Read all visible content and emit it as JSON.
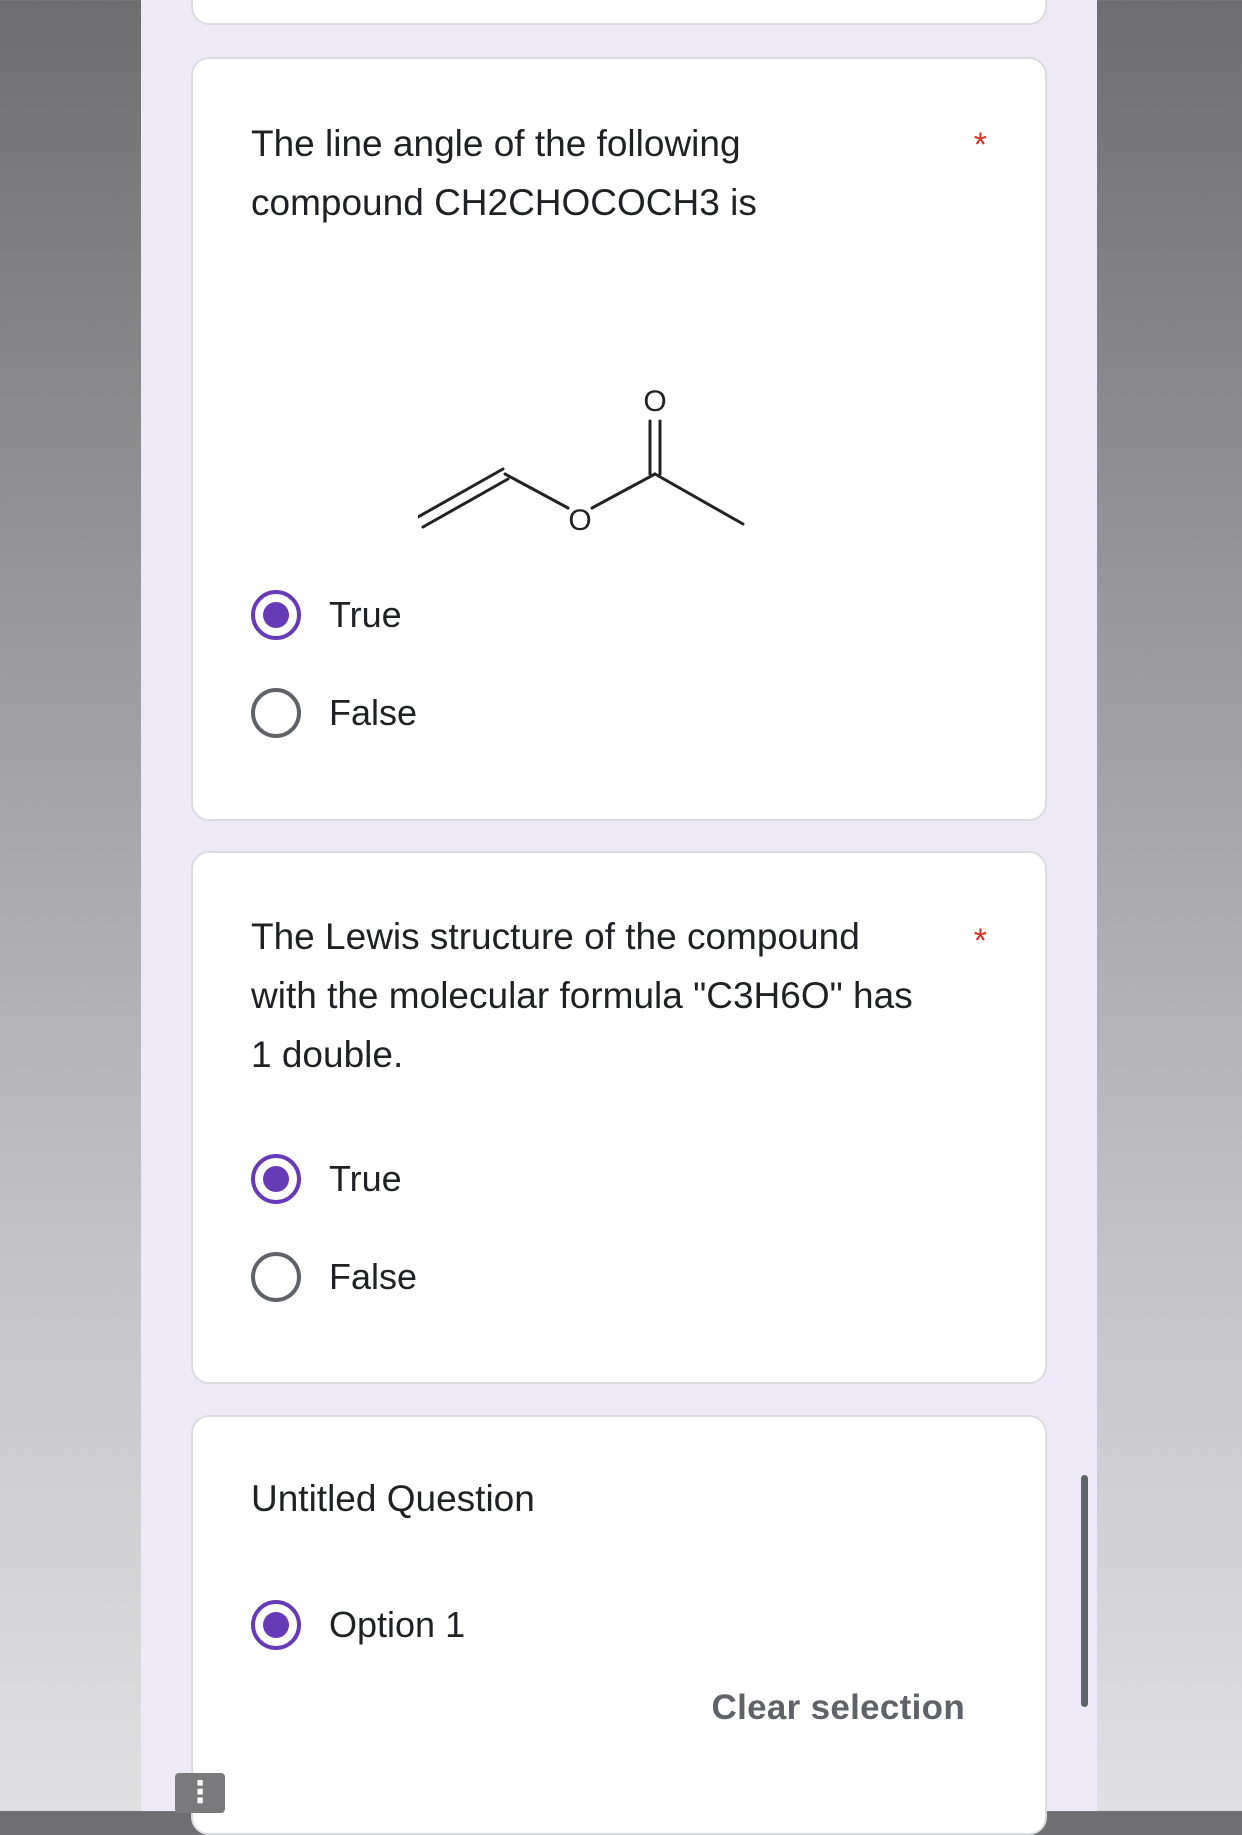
{
  "questions": [
    {
      "text_line1": "The line angle of the following",
      "text_line2": "compound CH2CHOCOCH3 is",
      "required_mark": "*",
      "structure_atom_labels": [
        "O",
        "O"
      ],
      "options": [
        {
          "label": "True",
          "selected": true
        },
        {
          "label": "False",
          "selected": false
        }
      ]
    },
    {
      "text_line1": "The Lewis structure of the compound",
      "text_line2": "with the molecular formula \"C3H6O\" has",
      "text_line3": "1 double.",
      "required_mark": "*",
      "options": [
        {
          "label": "True",
          "selected": true
        },
        {
          "label": "False",
          "selected": false
        }
      ]
    },
    {
      "text_line1": "Untitled Question",
      "options": [
        {
          "label": "Option 1",
          "selected": true
        }
      ],
      "clear_selection_label": "Clear selection"
    }
  ],
  "menu_button_glyph": "⋮",
  "colors": {
    "accent": "#673ab7",
    "required": "#d93025",
    "page_background": "#ede9f7",
    "card_border": "#dadce0"
  }
}
